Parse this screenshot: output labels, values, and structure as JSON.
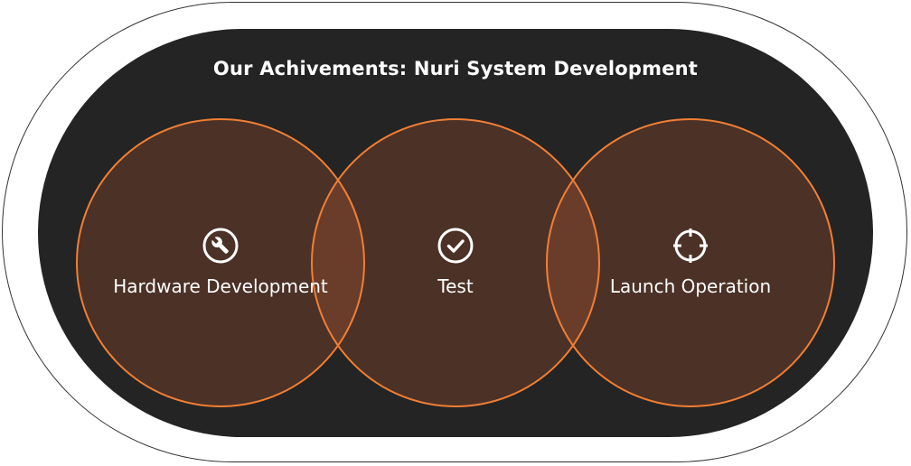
{
  "title": "Our Achivements: Nuri System Development",
  "stages": [
    {
      "label": "Hardware Development",
      "icon": "wrench-icon"
    },
    {
      "label": "Test",
      "icon": "checkmark-icon"
    },
    {
      "label": "Launch Operation",
      "icon": "crosshair-icon"
    }
  ],
  "colors": {
    "frame_border": "#333333",
    "panel": "#242424",
    "circle_fill": "#4b3126",
    "circle_overlap": "#6a3d2a",
    "circle_stroke": "#f07f35",
    "text": "#ffffff"
  }
}
